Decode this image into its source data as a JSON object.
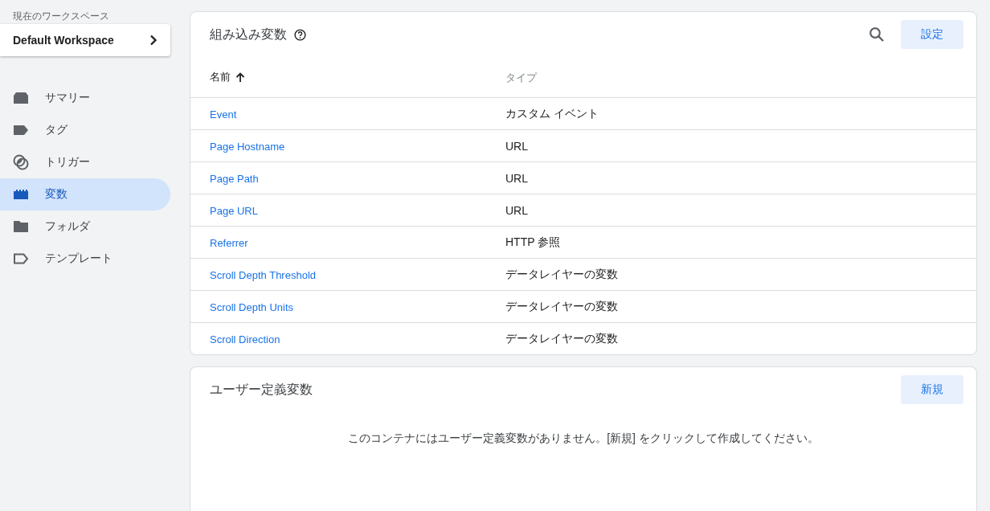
{
  "workspace": {
    "label": "現在のワークスペース",
    "name": "Default Workspace"
  },
  "nav": [
    {
      "label": "サマリー",
      "selected": false
    },
    {
      "label": "タグ",
      "selected": false
    },
    {
      "label": "トリガー",
      "selected": false
    },
    {
      "label": "変数",
      "selected": true
    },
    {
      "label": "フォルダ",
      "selected": false
    },
    {
      "label": "テンプレート",
      "selected": false
    }
  ],
  "builtin": {
    "title": "組み込み変数",
    "button": "設定",
    "columns": [
      "名前",
      "タイプ"
    ],
    "rows": [
      {
        "name": "Event",
        "type": "カスタム イベント"
      },
      {
        "name": "Page Hostname",
        "type": "URL"
      },
      {
        "name": "Page Path",
        "type": "URL"
      },
      {
        "name": "Page URL",
        "type": "URL"
      },
      {
        "name": "Referrer",
        "type": "HTTP 参照"
      },
      {
        "name": "Scroll Depth Threshold",
        "type": "データレイヤーの変数"
      },
      {
        "name": "Scroll Depth Units",
        "type": "データレイヤーの変数"
      },
      {
        "name": "Scroll Direction",
        "type": "データレイヤーの変数"
      }
    ]
  },
  "user_defined": {
    "title": "ユーザー定義変数",
    "button": "新規",
    "empty_message": "このコンテナにはユーザー定義変数がありません。[新規] をクリックして作成してください。"
  }
}
